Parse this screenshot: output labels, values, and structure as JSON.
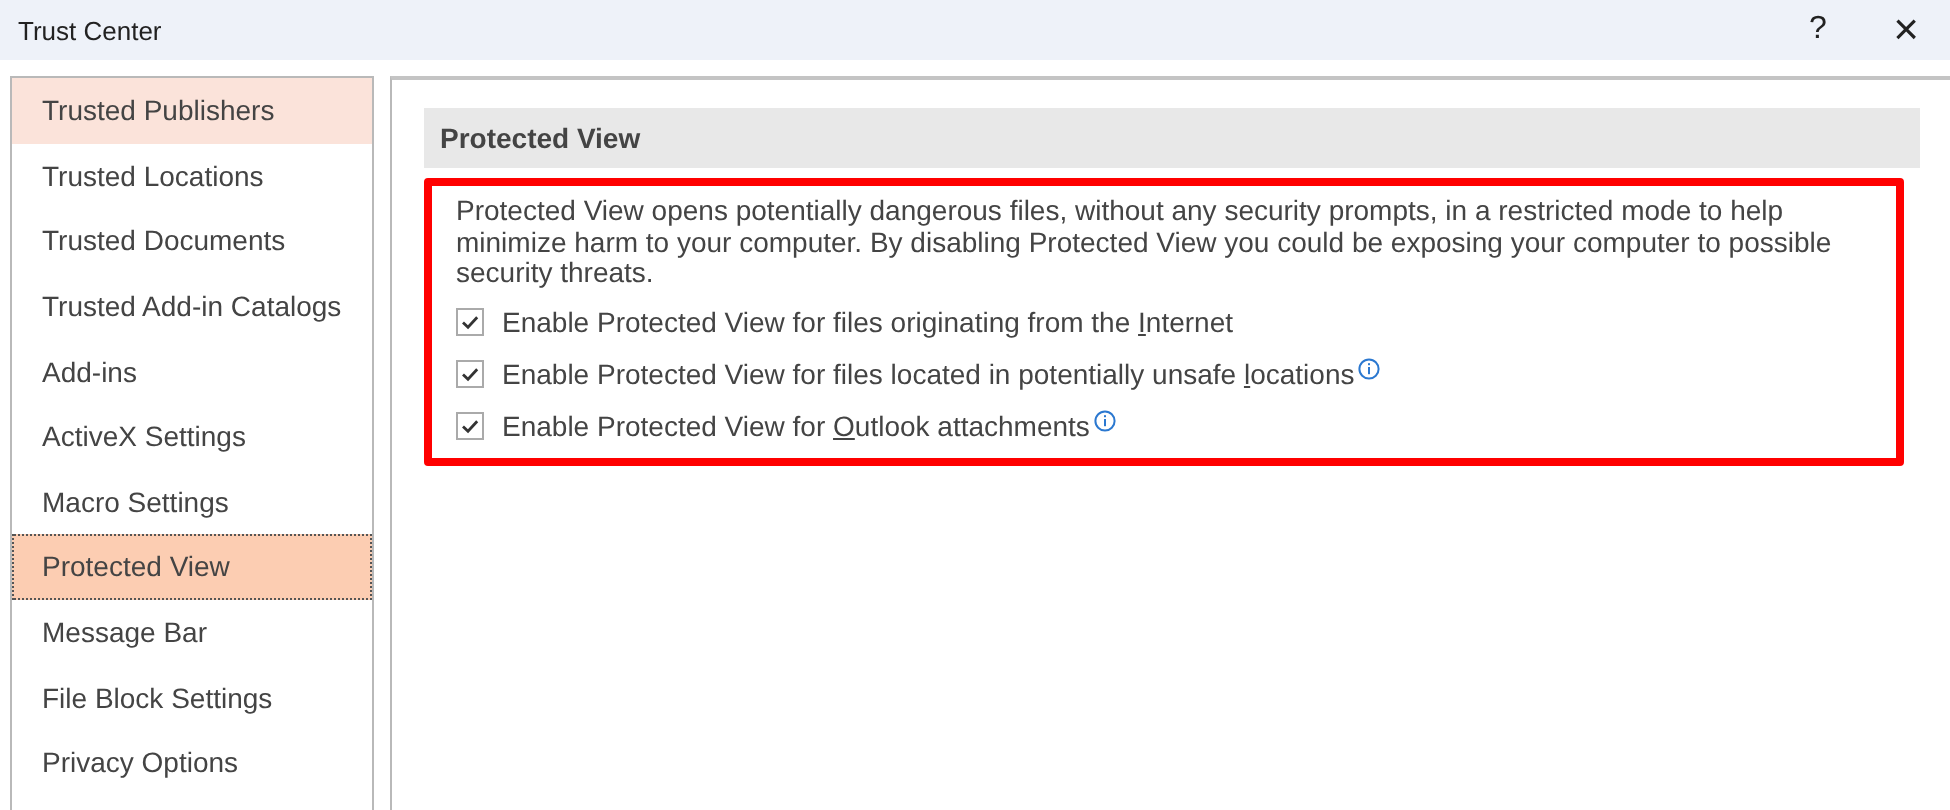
{
  "window": {
    "title": "Trust Center",
    "help": "?",
    "close": "×"
  },
  "sidebar": {
    "items": [
      {
        "label": "Trusted Publishers",
        "selected": false,
        "hovered": true
      },
      {
        "label": "Trusted Locations",
        "selected": false,
        "hovered": false
      },
      {
        "label": "Trusted Documents",
        "selected": false,
        "hovered": false
      },
      {
        "label": "Trusted Add-in Catalogs",
        "selected": false,
        "hovered": false
      },
      {
        "label": "Add-ins",
        "selected": false,
        "hovered": false
      },
      {
        "label": "ActiveX Settings",
        "selected": false,
        "hovered": false
      },
      {
        "label": "Macro Settings",
        "selected": false,
        "hovered": false
      },
      {
        "label": "Protected View",
        "selected": true,
        "hovered": false
      },
      {
        "label": "Message Bar",
        "selected": false,
        "hovered": false
      },
      {
        "label": "File Block Settings",
        "selected": false,
        "hovered": false
      },
      {
        "label": "Privacy Options",
        "selected": false,
        "hovered": false
      }
    ]
  },
  "section": {
    "title": "Protected View",
    "description": "Protected View opens potentially dangerous files, without any security prompts, in a restricted mode to help minimize harm to your computer. By disabling Protected View you could be exposing your computer to possible security threats.",
    "highlighted": true,
    "options": [
      {
        "label_before": "Enable Protected View for files originating from the ",
        "access_key": "I",
        "label_after": "nternet",
        "checked": true,
        "info": false
      },
      {
        "label_before": "Enable Protected View for files located in potentially unsafe ",
        "access_key": "l",
        "label_after": "ocations",
        "checked": true,
        "info": true
      },
      {
        "label_before": "Enable Protected View for ",
        "access_key": "O",
        "label_after": "utlook attachments",
        "checked": true,
        "info": true
      }
    ]
  }
}
